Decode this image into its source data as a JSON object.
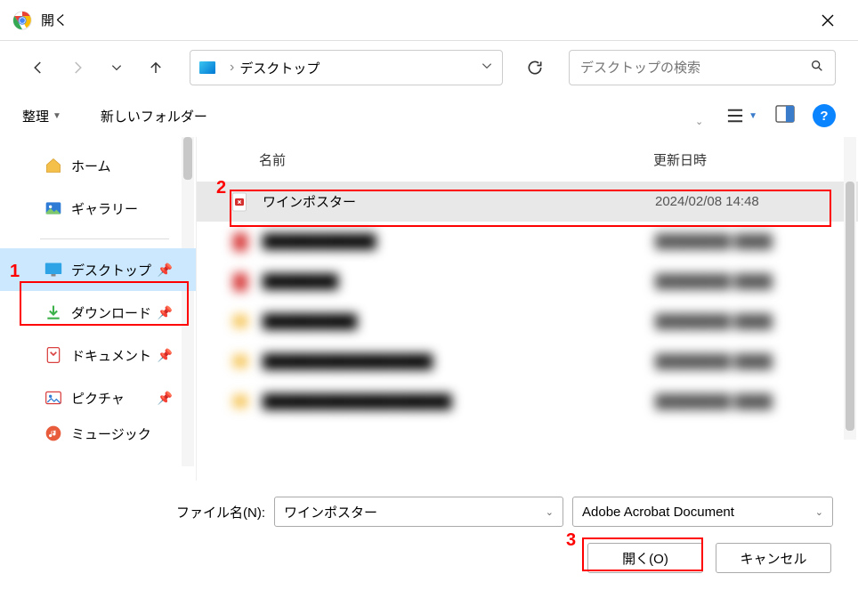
{
  "titlebar": {
    "title": "開く"
  },
  "nav": {
    "breadcrumb": "デスクトップ",
    "search_placeholder": "デスクトップの検索"
  },
  "toolbar": {
    "organize": "整理",
    "new_folder": "新しいフォルダー"
  },
  "sidebar": {
    "items": [
      {
        "label": "ホーム",
        "icon": "home"
      },
      {
        "label": "ギャラリー",
        "icon": "gallery"
      },
      {
        "label": "デスクトップ",
        "icon": "desktop",
        "active": true,
        "pinned": true
      },
      {
        "label": "ダウンロード",
        "icon": "download",
        "pinned": true
      },
      {
        "label": "ドキュメント",
        "icon": "document",
        "pinned": true
      },
      {
        "label": "ピクチャ",
        "icon": "picture",
        "pinned": true
      },
      {
        "label": "ミュージック",
        "icon": "music",
        "pinned": true
      }
    ]
  },
  "columns": {
    "name": "名前",
    "date": "更新日時"
  },
  "files": [
    {
      "name": "ワインポスター",
      "date": "2024/02/08 14:48",
      "type": "pdf",
      "selected": true
    }
  ],
  "footer": {
    "filename_label": "ファイル名(N):",
    "filename_value": "ワインポスター",
    "filetype": "Adobe Acrobat Document",
    "open": "開く(O)",
    "cancel": "キャンセル"
  },
  "annotations": {
    "a1": "1",
    "a2": "2",
    "a3": "3"
  }
}
